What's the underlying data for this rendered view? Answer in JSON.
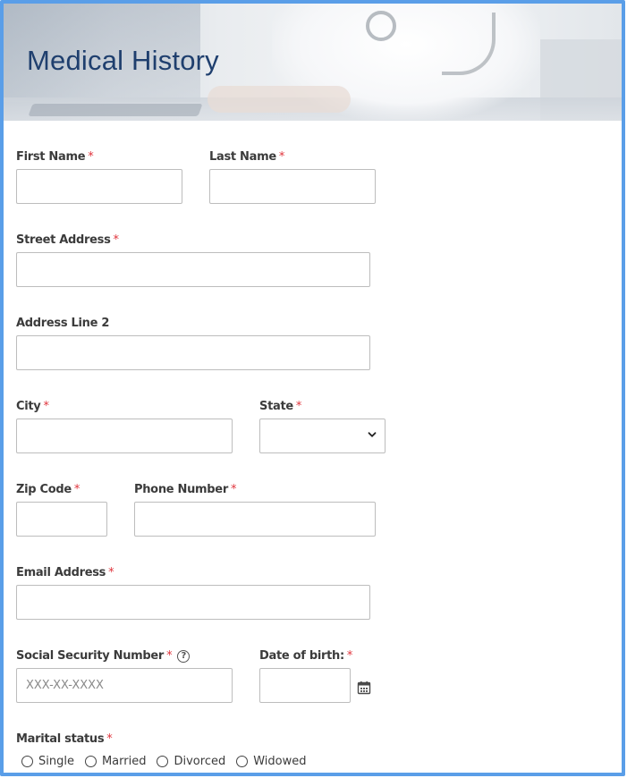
{
  "header": {
    "title": "Medical History"
  },
  "form": {
    "first_name": {
      "label": "First Name",
      "required": "*"
    },
    "last_name": {
      "label": "Last Name",
      "required": "*"
    },
    "street_address": {
      "label": "Street Address",
      "required": "*"
    },
    "address_line_2": {
      "label": "Address Line 2"
    },
    "city": {
      "label": "City",
      "required": "*"
    },
    "state": {
      "label": "State",
      "required": "*"
    },
    "zip_code": {
      "label": "Zip Code",
      "required": "*"
    },
    "phone_number": {
      "label": "Phone Number",
      "required": "*"
    },
    "email_address": {
      "label": "Email Address",
      "required": "*"
    },
    "ssn": {
      "label": "Social Security Number",
      "required": "*",
      "placeholder": "XXX-XX-XXXX",
      "help_icon": "?"
    },
    "dob": {
      "label": "Date of birth:",
      "required": "*"
    },
    "marital_status": {
      "label": "Marital status",
      "required": "*",
      "options": [
        "Single",
        "Married",
        "Divorced",
        "Widowed"
      ]
    }
  },
  "icons": {
    "state_dropdown": "chevron-down-icon",
    "dob_picker": "calendar-icon",
    "ssn_help": "help-icon"
  },
  "colors": {
    "frame_border": "#5a9ee8",
    "title": "#1f3f6e",
    "required_marker": "#e0343c"
  }
}
